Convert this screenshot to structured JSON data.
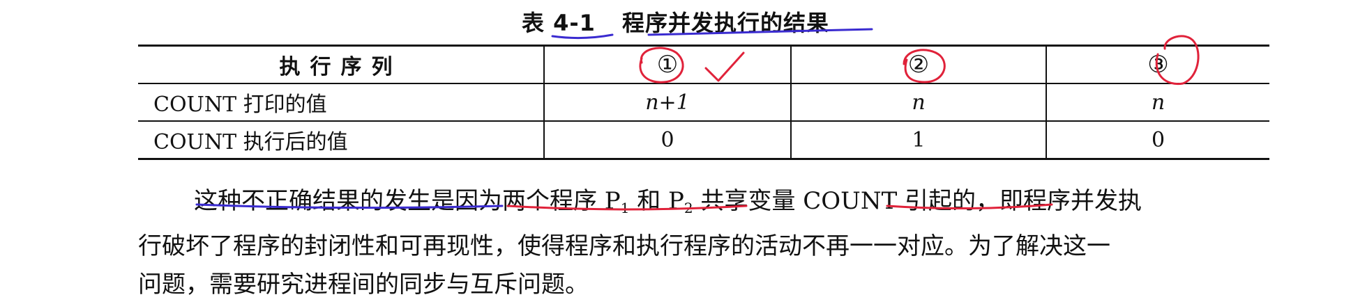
{
  "caption": {
    "number": "表 4-1",
    "title": "程序并发执行的结果"
  },
  "table": {
    "header_label": "执行序列",
    "columns": [
      "①",
      "②",
      "③"
    ],
    "rows": [
      {
        "label": "COUNT 打印的值",
        "values": [
          "n+1",
          "n",
          "n"
        ]
      },
      {
        "label": "COUNT 执行后的值",
        "values": [
          "0",
          "1",
          "0"
        ]
      }
    ]
  },
  "paragraph": {
    "line1_part1": "这种不正确结果的发生是因为两个程序 P",
    "p1_sub": "1",
    "line1_part2": " 和 P",
    "p2_sub": "2",
    "line1_part3": " 共享变量 COUNT 引起的，即程序并发执",
    "line2": "行破坏了程序的封闭性和可再现性，使得程序和执行程序的活动不再一一对应。为了解决这一",
    "line3": "问题，需要研究进程间的同步与互斥问题。"
  },
  "annotations": {
    "pen_blue": "#3a2bd0",
    "pen_red": "#e0223a"
  }
}
